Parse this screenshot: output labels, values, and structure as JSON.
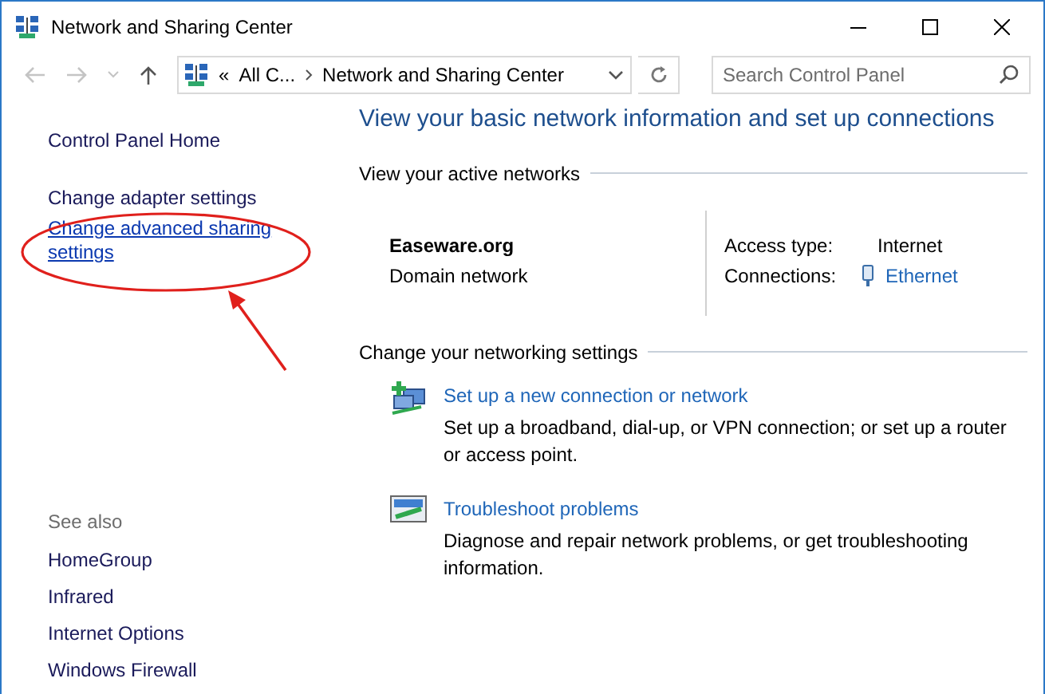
{
  "window": {
    "title": "Network and Sharing Center"
  },
  "nav": {
    "back_disabled": true,
    "forward_disabled": true,
    "overflow": "«",
    "breadcrumb": [
      "All C...",
      "Network and Sharing Center"
    ],
    "search_placeholder": "Search Control Panel"
  },
  "sidebar": {
    "items": [
      {
        "label": "Control Panel Home",
        "kind": "plain"
      },
      {
        "label": "Change adapter settings",
        "kind": "plain"
      },
      {
        "label": "Change advanced sharing settings",
        "kind": "link"
      }
    ],
    "see_also_heading": "See also",
    "see_also": [
      "HomeGroup",
      "Infrared",
      "Internet Options",
      "Windows Firewall"
    ]
  },
  "main": {
    "title": "View your basic network information and set up connections",
    "active_heading": "View your active networks",
    "network": {
      "name": "Easeware.org",
      "type": "Domain network",
      "access_label": "Access type:",
      "access_value": "Internet",
      "connections_label": "Connections:",
      "connection": "Ethernet"
    },
    "settings_heading": "Change your networking settings",
    "tasks": [
      {
        "kind": "setup",
        "title": "Set up a new connection or network",
        "description": "Set up a broadband, dial-up, or VPN connection; or set up a router or access point."
      },
      {
        "kind": "troubleshoot",
        "title": "Troubleshoot problems",
        "description": "Diagnose and repair network problems, or get troubleshooting information."
      }
    ]
  },
  "annotations": {
    "highlight_ellipse": {
      "color": "#e0201c"
    },
    "pointer_arrow": {
      "color": "#e0201c"
    }
  }
}
